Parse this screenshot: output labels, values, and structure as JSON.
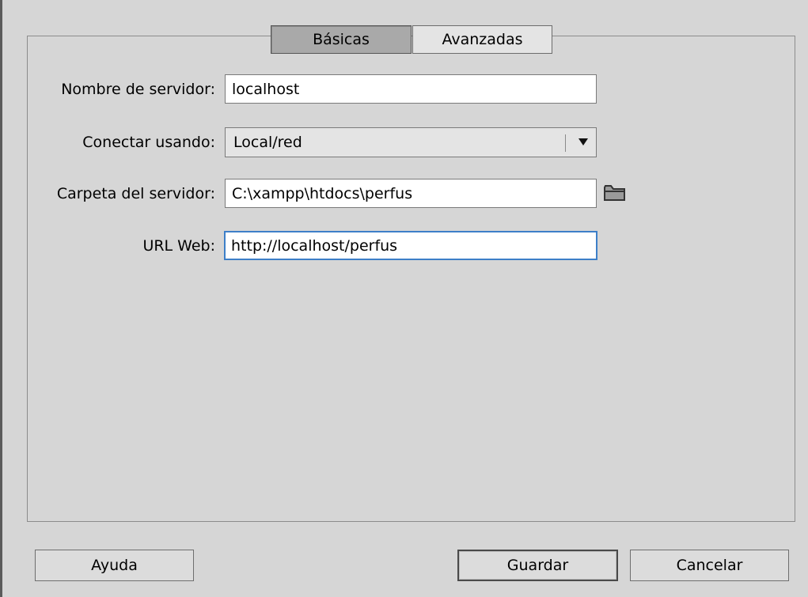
{
  "tabs": {
    "basic": "Básicas",
    "advanced": "Avanzadas"
  },
  "form": {
    "server_name_label": "Nombre de servidor:",
    "server_name_value": "localhost",
    "connect_using_label": "Conectar usando:",
    "connect_using_value": "Local/red",
    "server_folder_label": "Carpeta del servidor:",
    "server_folder_value": "C:\\xampp\\htdocs\\perfus",
    "web_url_label": "URL Web:",
    "web_url_value": "http://localhost/perfus"
  },
  "icons": {
    "browse_folder": "folder-icon",
    "dropdown": "chevron-down-icon"
  },
  "buttons": {
    "help": "Ayuda",
    "save": "Guardar",
    "cancel": "Cancelar"
  },
  "colors": {
    "background": "#d6d6d6",
    "active_tab": "#a9a9a9",
    "focus_border": "#3d7fc8"
  }
}
